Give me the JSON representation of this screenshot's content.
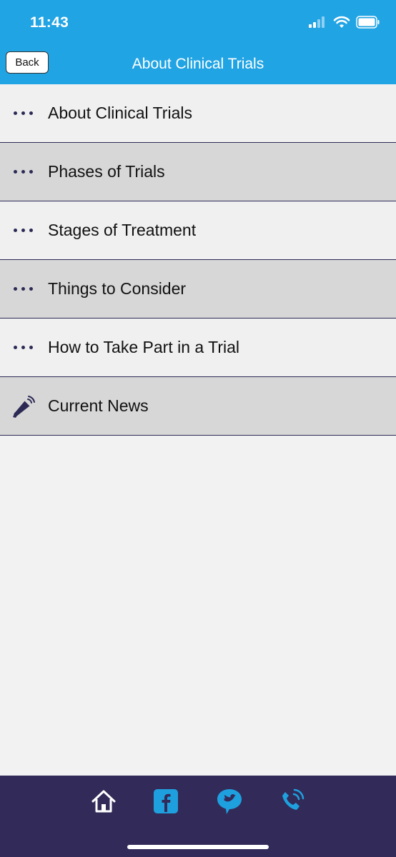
{
  "status_bar": {
    "time": "11:43"
  },
  "nav": {
    "back_label": "Back",
    "title": "About Clinical Trials"
  },
  "menu": {
    "items": [
      {
        "label": "About Clinical Trials",
        "icon": "dots-icon"
      },
      {
        "label": "Phases of Trials",
        "icon": "dots-icon"
      },
      {
        "label": "Stages of Treatment",
        "icon": "dots-icon"
      },
      {
        "label": "Things to Consider",
        "icon": "dots-icon"
      },
      {
        "label": "How to Take Part in a Trial",
        "icon": "dots-icon"
      },
      {
        "label": "Current News",
        "icon": "megaphone-icon"
      }
    ]
  },
  "tab_bar": {
    "icons": [
      "home-icon",
      "facebook-icon",
      "twitter-icon",
      "phone-icon"
    ]
  },
  "colors": {
    "header": "#21a4e4",
    "tab_bar": "#322a58",
    "accent_icon": "#1fa0de",
    "row_light": "#f0f0f0",
    "row_dark": "#d7d7d7",
    "divider": "#2c2a55"
  }
}
